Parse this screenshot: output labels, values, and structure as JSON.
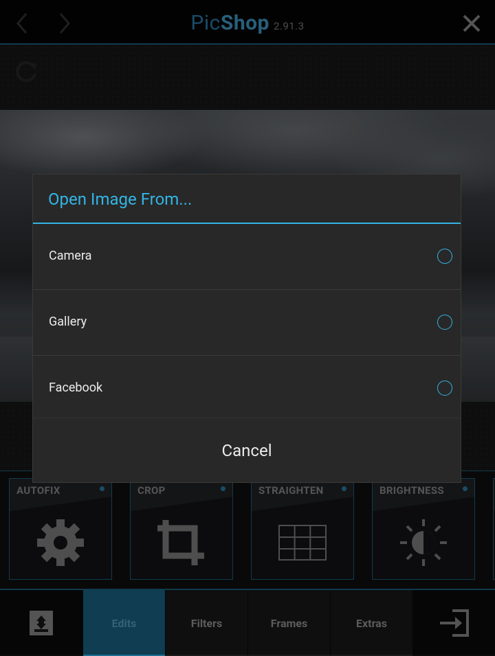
{
  "app": {
    "name_part1": "Pic",
    "name_part2": "Shop",
    "version": "2.91.3"
  },
  "dialog": {
    "title": "Open Image From...",
    "options": [
      {
        "label": "Camera",
        "icon": "radio-icon"
      },
      {
        "label": "Gallery",
        "icon": "radio-icon"
      },
      {
        "label": "Facebook",
        "icon": "radio-icon"
      }
    ],
    "cancel_label": "Cancel"
  },
  "tools": [
    {
      "label": "AUTOFIX",
      "icon": "gear-icon"
    },
    {
      "label": "CROP",
      "icon": "crop-icon"
    },
    {
      "label": "STRAIGHTEN",
      "icon": "grid-icon"
    },
    {
      "label": "BRIGHTNESS",
      "icon": "brightness-icon"
    }
  ],
  "bottom_nav": {
    "tabs": [
      {
        "label": "Edits",
        "active": true
      },
      {
        "label": "Filters",
        "active": false
      },
      {
        "label": "Frames",
        "active": false
      },
      {
        "label": "Extras",
        "active": false
      }
    ]
  },
  "colors": {
    "accent": "#33b5e5",
    "brand_blue": "#2e8dbc",
    "active_tab": "#1e6f94",
    "dialog_bg": "#282828"
  }
}
